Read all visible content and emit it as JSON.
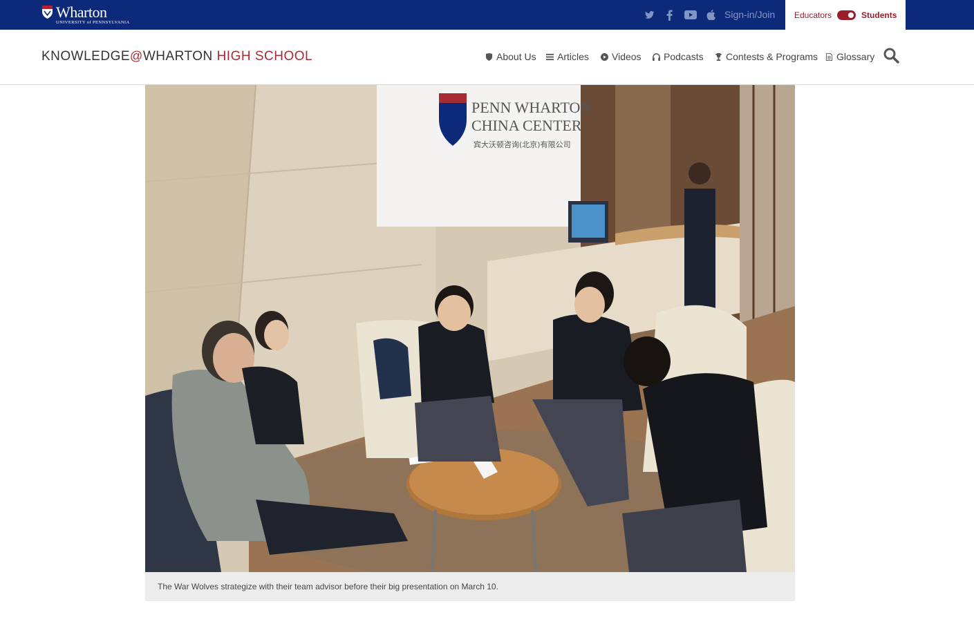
{
  "topbar": {
    "logo": {
      "name": "Wharton",
      "subtitle": "UNIVERSITY of PENNSYLVANIA"
    },
    "social_icons": [
      "twitter-icon",
      "facebook-icon",
      "youtube-icon",
      "apple-icon"
    ],
    "signin_label": "Sign-in/Join",
    "audience": {
      "educators_label": "Educators",
      "students_label": "Students",
      "selected": "Students"
    }
  },
  "header": {
    "brand": {
      "part1": "KNOWLEDGE",
      "at": "@",
      "part2": "WHARTON",
      "part3": "HIGH SCHOOL"
    },
    "nav": [
      {
        "label": "About Us",
        "icon": "shield-icon"
      },
      {
        "label": "Articles",
        "icon": "list-icon"
      },
      {
        "label": "Videos",
        "icon": "play-icon"
      },
      {
        "label": "Podcasts",
        "icon": "headphones-icon"
      },
      {
        "label": "Contests & Programs",
        "icon": "trophy-icon"
      },
      {
        "label": "Glossary",
        "icon": "document-icon"
      }
    ],
    "search_icon": "search-icon"
  },
  "photo": {
    "sign_line1": "PENN WHARTON",
    "sign_line2": "CHINA CENTER",
    "sign_line3": "宾大沃顿咨询(北京)有限公司"
  },
  "caption": "The War Wolves strategize with their team advisor before their big presentation on March 10.",
  "colors": {
    "navy": "#0d2a7a",
    "brand_red": "#a82a32",
    "caption_bg": "#ececec"
  }
}
